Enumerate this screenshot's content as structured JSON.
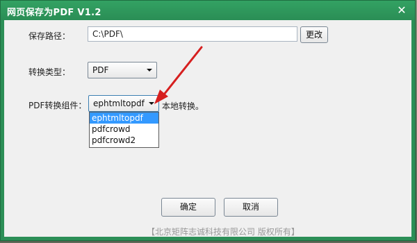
{
  "window": {
    "title": "网页保存为PDF  V1.2",
    "close_glyph": "✕"
  },
  "form": {
    "save_path_label": "保存路径：",
    "save_path_value": "C:\\PDF\\",
    "change_button": "更改",
    "convert_type_label": "转换类型：",
    "convert_type_value": "PDF",
    "component_label": "PDF转换组件：",
    "component_value": "ephtmltopdf",
    "component_note": "本地转换。",
    "component_options": [
      "ephtmltopdf",
      "pdfcrowd",
      "pdfcrowd2"
    ]
  },
  "actions": {
    "ok": "确定",
    "cancel": "取消"
  },
  "footer": {
    "copyright": "【北京矩阵志诚科技有限公司 版权所有】"
  },
  "colors": {
    "titlebar": "#2c8f57",
    "annotation_arrow": "#d61f1f",
    "selected_option": "#3399ff"
  }
}
